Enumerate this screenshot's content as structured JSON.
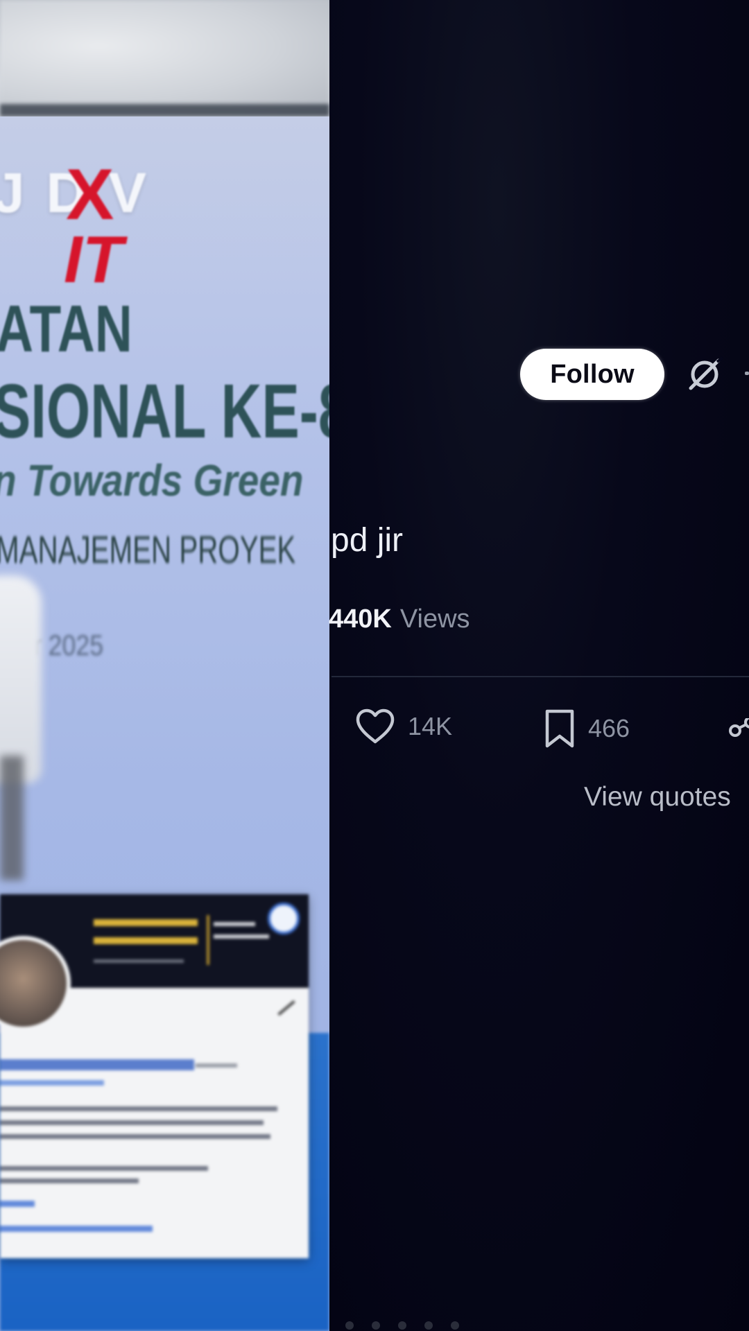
{
  "photo": {
    "banner_logo": "J D V",
    "banner_logo_x": "X",
    "banner_it": "IT",
    "banner_line1": "ATAN",
    "banner_line2": "SIONAL KE-8",
    "banner_line3": "n Towards Green",
    "banner_line4": "MANAJEMEN PROYEK",
    "banner_date": "er 2025"
  },
  "post": {
    "follow_label": "Follow",
    "text": "pd jir",
    "views_count": "440K",
    "views_label": "Views",
    "likes_count": "14K",
    "bookmarks_count": "466",
    "view_quotes_label": "View quotes"
  },
  "colors": {
    "panel_background": "#050515",
    "follow_button": "#ffffff",
    "muted_text": "#8e94a3",
    "banner_red": "#d6152b",
    "banner_teal": "#2e5258"
  },
  "icons": {
    "grok": "grok-icon",
    "like": "heart-icon",
    "bookmark": "bookmark-icon",
    "share": "share-icon"
  }
}
